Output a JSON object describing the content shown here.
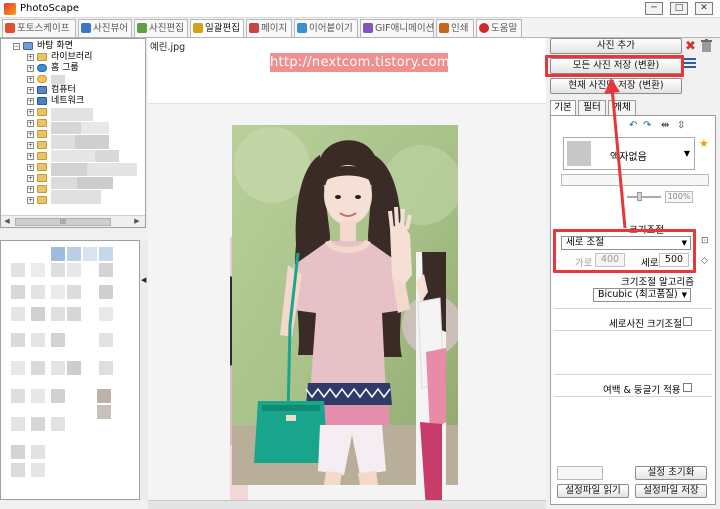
{
  "window": {
    "title": "PhotoScape",
    "controls": [
      "─",
      "□",
      "✕"
    ]
  },
  "tabs": [
    {
      "label": "포토스케이프",
      "color": "#e34f2e"
    },
    {
      "label": "사진뷰어",
      "color": "#3c78c8"
    },
    {
      "label": "사진편집",
      "color": "#5aa144"
    },
    {
      "label": "일괄편집",
      "color": "#d7a21b"
    },
    {
      "label": "페이지",
      "color": "#c84343"
    },
    {
      "label": "이어붙이기",
      "color": "#3b8fd0"
    },
    {
      "label": "GIF애니메이션",
      "color": "#8455b8"
    },
    {
      "label": "인쇄",
      "color": "#c8651f"
    },
    {
      "label": "도움말",
      "color": "#d02828"
    }
  ],
  "tree": {
    "items": [
      {
        "label": "바탕 화면"
      },
      {
        "label": "라이브러리"
      },
      {
        "label": "홈 그룹"
      },
      {
        "label": ""
      },
      {
        "label": "컴퓨터"
      },
      {
        "label": "네트워크"
      }
    ],
    "scroll_thumb": "III"
  },
  "viewer": {
    "filename": "예린.jpg",
    "watermark": "http://nextcom.tistory.com"
  },
  "right_panel": {
    "add_photo": "사진 추가",
    "save_all": "모든 사진 저장 (변환)",
    "save_current": "현재 사진만 저장 (변환)",
    "subtabs": [
      "기본",
      "필터",
      "개체"
    ],
    "frame": "액자없음",
    "percent": "100%",
    "resize_title": "크기조절",
    "resize_mode": "세로 조절",
    "width_label": "가로",
    "width_value": "400",
    "height_label": "세로",
    "height_value": "500",
    "algorithm_title": "크기조절 알고리즘",
    "algorithm": "Bicubic (최고품질)",
    "portrait_resize": "세로사진 크기조절",
    "margin_round": "여백 & 둥글기 적용",
    "reset_settings": "설정 초기화",
    "load_settings": "설정파일 읽기",
    "save_settings": "설정파일 저장"
  }
}
